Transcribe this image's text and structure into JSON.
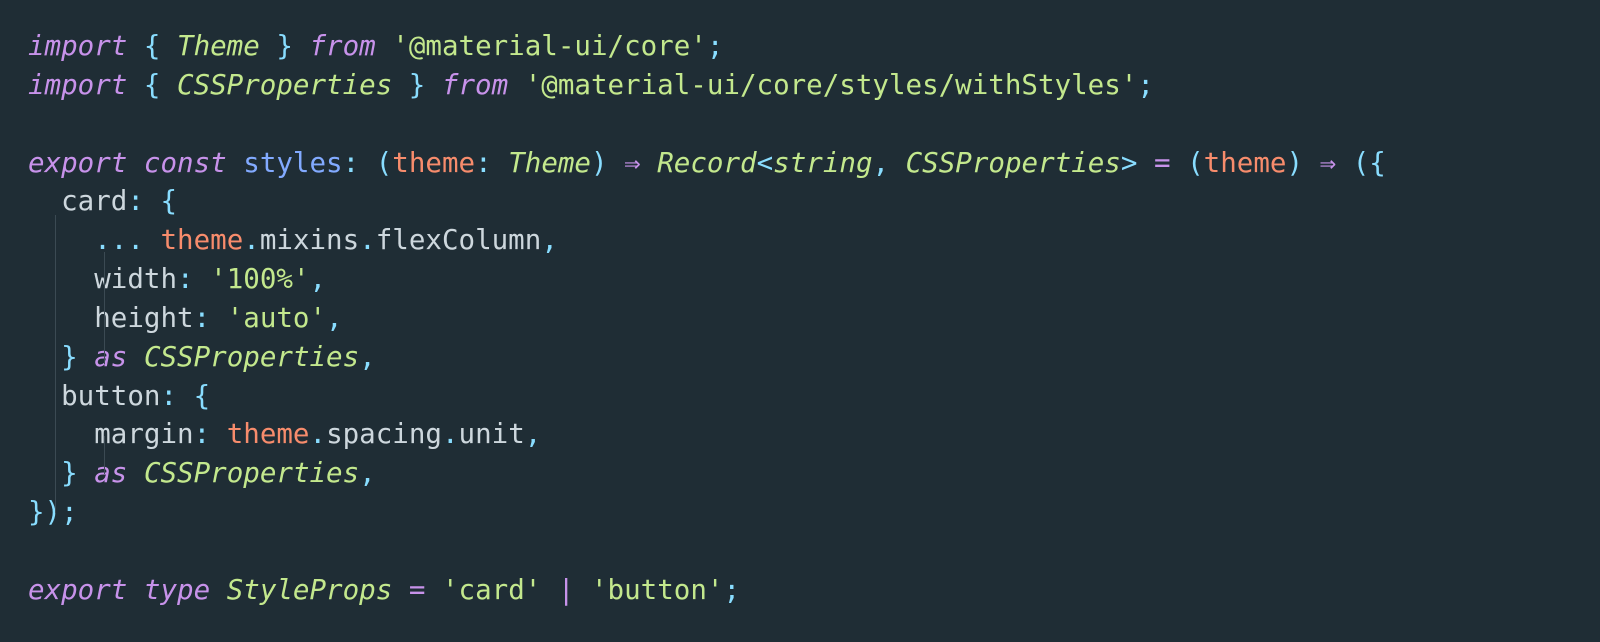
{
  "code": {
    "lines": [
      [
        {
          "c": "k",
          "t": "import"
        },
        {
          "c": "pu",
          "t": " { "
        },
        {
          "c": "ty",
          "t": "Theme"
        },
        {
          "c": "pu",
          "t": " } "
        },
        {
          "c": "k",
          "t": "from"
        },
        {
          "c": "pr",
          "t": " "
        },
        {
          "c": "s",
          "t": "'@material-ui/core'"
        },
        {
          "c": "pu",
          "t": ";"
        }
      ],
      [
        {
          "c": "k",
          "t": "import"
        },
        {
          "c": "pu",
          "t": " { "
        },
        {
          "c": "ty",
          "t": "CSSProperties"
        },
        {
          "c": "pu",
          "t": " } "
        },
        {
          "c": "k",
          "t": "from"
        },
        {
          "c": "pr",
          "t": " "
        },
        {
          "c": "s",
          "t": "'@material-ui/core/styles/withStyles'"
        },
        {
          "c": "pu",
          "t": ";"
        }
      ],
      [],
      [
        {
          "c": "k",
          "t": "export"
        },
        {
          "c": "pr",
          "t": " "
        },
        {
          "c": "k",
          "t": "const"
        },
        {
          "c": "pr",
          "t": " "
        },
        {
          "c": "id",
          "t": "styles"
        },
        {
          "c": "pu",
          "t": ": ("
        },
        {
          "c": "pa",
          "t": "theme"
        },
        {
          "c": "pu",
          "t": ": "
        },
        {
          "c": "ty",
          "t": "Theme"
        },
        {
          "c": "pu",
          "t": ") "
        },
        {
          "c": "k",
          "t": "⇒"
        },
        {
          "c": "pr",
          "t": " "
        },
        {
          "c": "ty",
          "t": "Record"
        },
        {
          "c": "pu",
          "t": "<"
        },
        {
          "c": "ty",
          "t": "string"
        },
        {
          "c": "pu",
          "t": ", "
        },
        {
          "c": "ty",
          "t": "CSSProperties"
        },
        {
          "c": "pu",
          "t": "> "
        },
        {
          "c": "op",
          "t": "="
        },
        {
          "c": "pr",
          "t": " "
        },
        {
          "c": "pu",
          "t": "("
        },
        {
          "c": "pa",
          "t": "theme"
        },
        {
          "c": "pu",
          "t": ") "
        },
        {
          "c": "k",
          "t": "⇒"
        },
        {
          "c": "pr",
          "t": " "
        },
        {
          "c": "pu",
          "t": "({"
        }
      ],
      [
        {
          "c": "pr",
          "t": "  "
        },
        {
          "c": "pr",
          "t": "card"
        },
        {
          "c": "pu",
          "t": ": {"
        }
      ],
      [
        {
          "c": "pr",
          "t": "    "
        },
        {
          "c": "pu",
          "t": "... "
        },
        {
          "c": "pa",
          "t": "theme"
        },
        {
          "c": "pu",
          "t": "."
        },
        {
          "c": "pr",
          "t": "mixins"
        },
        {
          "c": "pu",
          "t": "."
        },
        {
          "c": "pr",
          "t": "flexColumn"
        },
        {
          "c": "pu",
          "t": ","
        }
      ],
      [
        {
          "c": "pr",
          "t": "    "
        },
        {
          "c": "pr",
          "t": "width"
        },
        {
          "c": "pu",
          "t": ": "
        },
        {
          "c": "s",
          "t": "'100%'"
        },
        {
          "c": "pu",
          "t": ","
        }
      ],
      [
        {
          "c": "pr",
          "t": "    "
        },
        {
          "c": "pr",
          "t": "height"
        },
        {
          "c": "pu",
          "t": ": "
        },
        {
          "c": "s",
          "t": "'auto'"
        },
        {
          "c": "pu",
          "t": ","
        }
      ],
      [
        {
          "c": "pr",
          "t": "  "
        },
        {
          "c": "pu",
          "t": "} "
        },
        {
          "c": "k",
          "t": "as"
        },
        {
          "c": "pr",
          "t": " "
        },
        {
          "c": "ty",
          "t": "CSSProperties"
        },
        {
          "c": "pu",
          "t": ","
        }
      ],
      [
        {
          "c": "pr",
          "t": "  "
        },
        {
          "c": "pr",
          "t": "button"
        },
        {
          "c": "pu",
          "t": ": {"
        }
      ],
      [
        {
          "c": "pr",
          "t": "    "
        },
        {
          "c": "pr",
          "t": "margin"
        },
        {
          "c": "pu",
          "t": ": "
        },
        {
          "c": "pa",
          "t": "theme"
        },
        {
          "c": "pu",
          "t": "."
        },
        {
          "c": "pr",
          "t": "spacing"
        },
        {
          "c": "pu",
          "t": "."
        },
        {
          "c": "pr",
          "t": "unit"
        },
        {
          "c": "pu",
          "t": ","
        }
      ],
      [
        {
          "c": "pr",
          "t": "  "
        },
        {
          "c": "pu",
          "t": "} "
        },
        {
          "c": "k",
          "t": "as"
        },
        {
          "c": "pr",
          "t": " "
        },
        {
          "c": "ty",
          "t": "CSSProperties"
        },
        {
          "c": "pu",
          "t": ","
        }
      ],
      [
        {
          "c": "pu",
          "t": "});"
        }
      ],
      [],
      [
        {
          "c": "k",
          "t": "export"
        },
        {
          "c": "pr",
          "t": " "
        },
        {
          "c": "k",
          "t": "type"
        },
        {
          "c": "pr",
          "t": " "
        },
        {
          "c": "ty",
          "t": "StyleProps"
        },
        {
          "c": "pr",
          "t": " "
        },
        {
          "c": "op",
          "t": "="
        },
        {
          "c": "pr",
          "t": " "
        },
        {
          "c": "s",
          "t": "'card'"
        },
        {
          "c": "pr",
          "t": " "
        },
        {
          "c": "op",
          "t": "|"
        },
        {
          "c": "pr",
          "t": " "
        },
        {
          "c": "s",
          "t": "'button'"
        },
        {
          "c": "pu",
          "t": ";"
        }
      ]
    ]
  }
}
